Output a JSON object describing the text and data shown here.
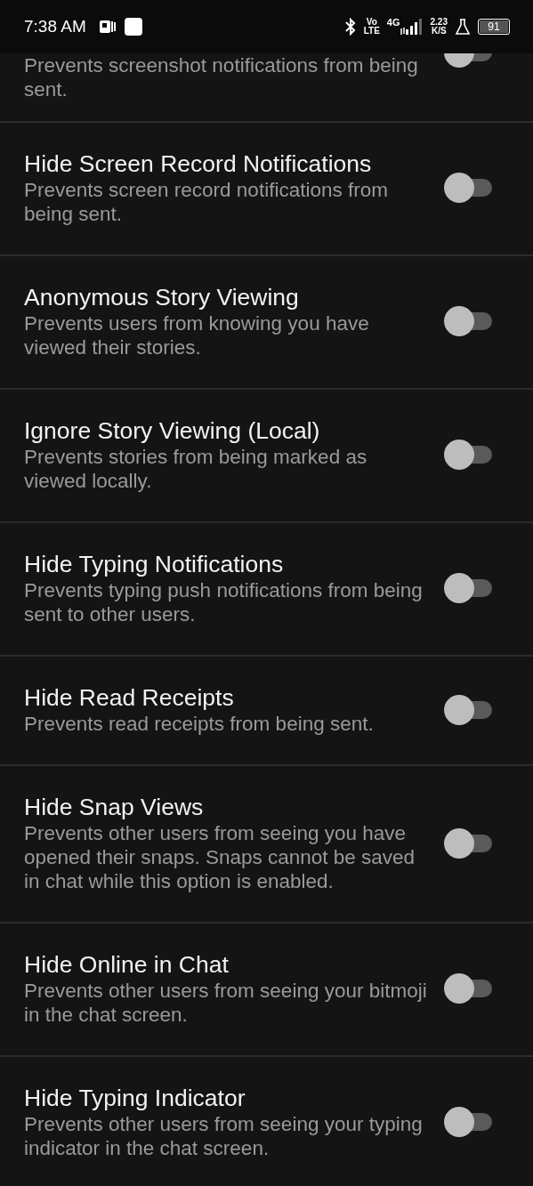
{
  "status_bar": {
    "time": "7:38 AM",
    "volte_top": "Vo",
    "volte_bottom": "LTE",
    "network": "4G",
    "speed_value": "2.23",
    "speed_unit": "K/S",
    "battery": "91"
  },
  "settings": [
    {
      "kind": "partial",
      "description": "Prevents screenshot notifications from being sent.",
      "on": false
    },
    {
      "kind": "full",
      "title": "Hide Screen Record Notifications",
      "description": "Prevents screen record notifications from being sent.",
      "on": false
    },
    {
      "kind": "full",
      "title": "Anonymous Story Viewing",
      "description": "Prevents users from knowing you have viewed their stories.",
      "on": false
    },
    {
      "kind": "full",
      "title": "Ignore Story Viewing (Local)",
      "description": "Prevents stories from being marked as viewed locally.",
      "on": false
    },
    {
      "kind": "full",
      "title": "Hide Typing Notifications",
      "description": "Prevents typing push notifications from being sent to other users.",
      "on": false
    },
    {
      "kind": "full",
      "title": "Hide Read Receipts",
      "description": "Prevents read receipts from being sent.",
      "on": false
    },
    {
      "kind": "full",
      "title": "Hide Snap Views",
      "description": "Prevents other users from seeing you have opened their snaps. Snaps cannot be saved in chat while this option is enabled.",
      "on": false
    },
    {
      "kind": "full",
      "title": "Hide Online in Chat",
      "description": "Prevents other users from seeing your bitmoji in the chat screen.",
      "on": false
    },
    {
      "kind": "full",
      "title": "Hide Typing Indicator",
      "description": "Prevents other users from seeing your typing indicator in the chat screen.",
      "on": false
    }
  ]
}
